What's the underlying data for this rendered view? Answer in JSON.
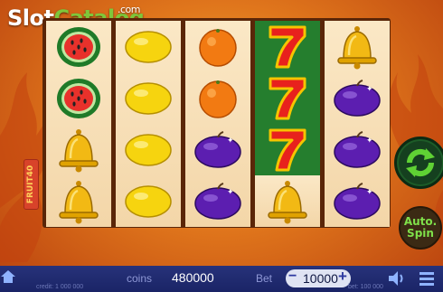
{
  "watermark": {
    "slot": "Slot",
    "catalog": "Catalog",
    "com": ".com"
  },
  "game_logo": "FRUIT40",
  "reels": [
    [
      "watermelon",
      "watermelon",
      "bell",
      "bell"
    ],
    [
      "lemon",
      "lemon",
      "lemon",
      "lemon"
    ],
    [
      "orange",
      "orange",
      "plum",
      "plum"
    ],
    [
      "seven",
      "seven",
      "seven",
      "bell"
    ],
    [
      "bell",
      "plum",
      "plum",
      "plum"
    ]
  ],
  "highlighted_reel": 3,
  "controls": {
    "spin_icon": "refresh-arrows-icon",
    "autospin_line1": "Auto.",
    "autospin_line2": "Spin"
  },
  "bottom_bar": {
    "home_icon": "home-icon",
    "coins_label": "coins",
    "coins_value": "480000",
    "bet_label": "Bet",
    "bet_minus": "−",
    "bet_value": "10000",
    "bet_plus": "+",
    "sound_icon": "speaker-icon",
    "menu_icon": "hamburger-menu-icon",
    "credit_line": "credit: 1 000 000",
    "win_line": "bet: 100 000"
  },
  "colors": {
    "accent_green": "#7fc63a",
    "bar": "#1f2a6e",
    "reel_highlight": "#257e2e"
  }
}
